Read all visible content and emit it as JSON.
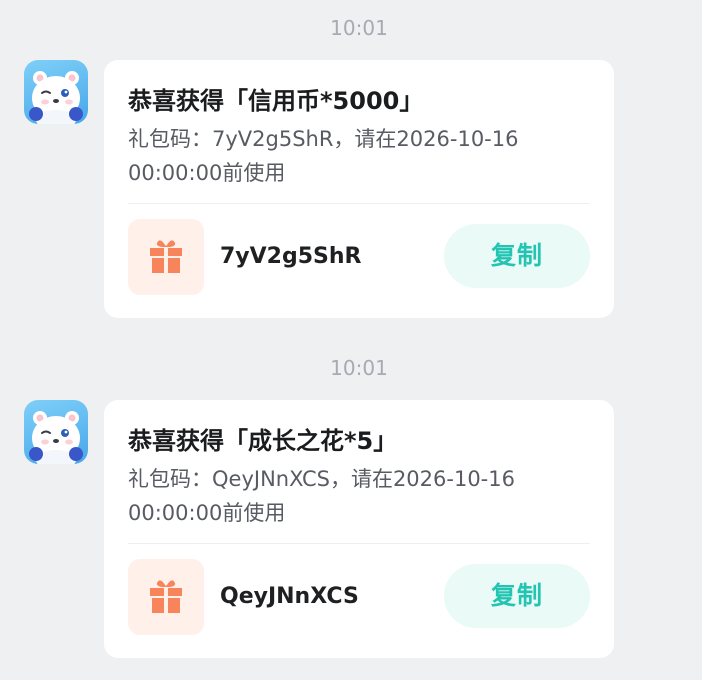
{
  "messages": [
    {
      "time": "10:01",
      "title": "恭喜获得「信用币*5000」",
      "description": "礼包码：7yV2g5ShR，请在2026-10-16 00:00:00前使用",
      "code": "7yV2g5ShR",
      "copy_label": "复制"
    },
    {
      "time": "10:01",
      "title": "恭喜获得「成长之花*5」",
      "description": "礼包码：QeyJNnXCS，请在2026-10-16 00:00:00前使用",
      "code": "QeyJNnXCS",
      "copy_label": "复制"
    }
  ],
  "icons": {
    "avatar": "bear-mascot-avatar",
    "gift": "gift-icon"
  },
  "colors": {
    "background": "#eff0f2",
    "card": "#ffffff",
    "accent": "#23c4b2",
    "accent_bg": "#e9faf7",
    "gift_icon": "#f7845b",
    "gift_bg": "#fff0ea"
  }
}
